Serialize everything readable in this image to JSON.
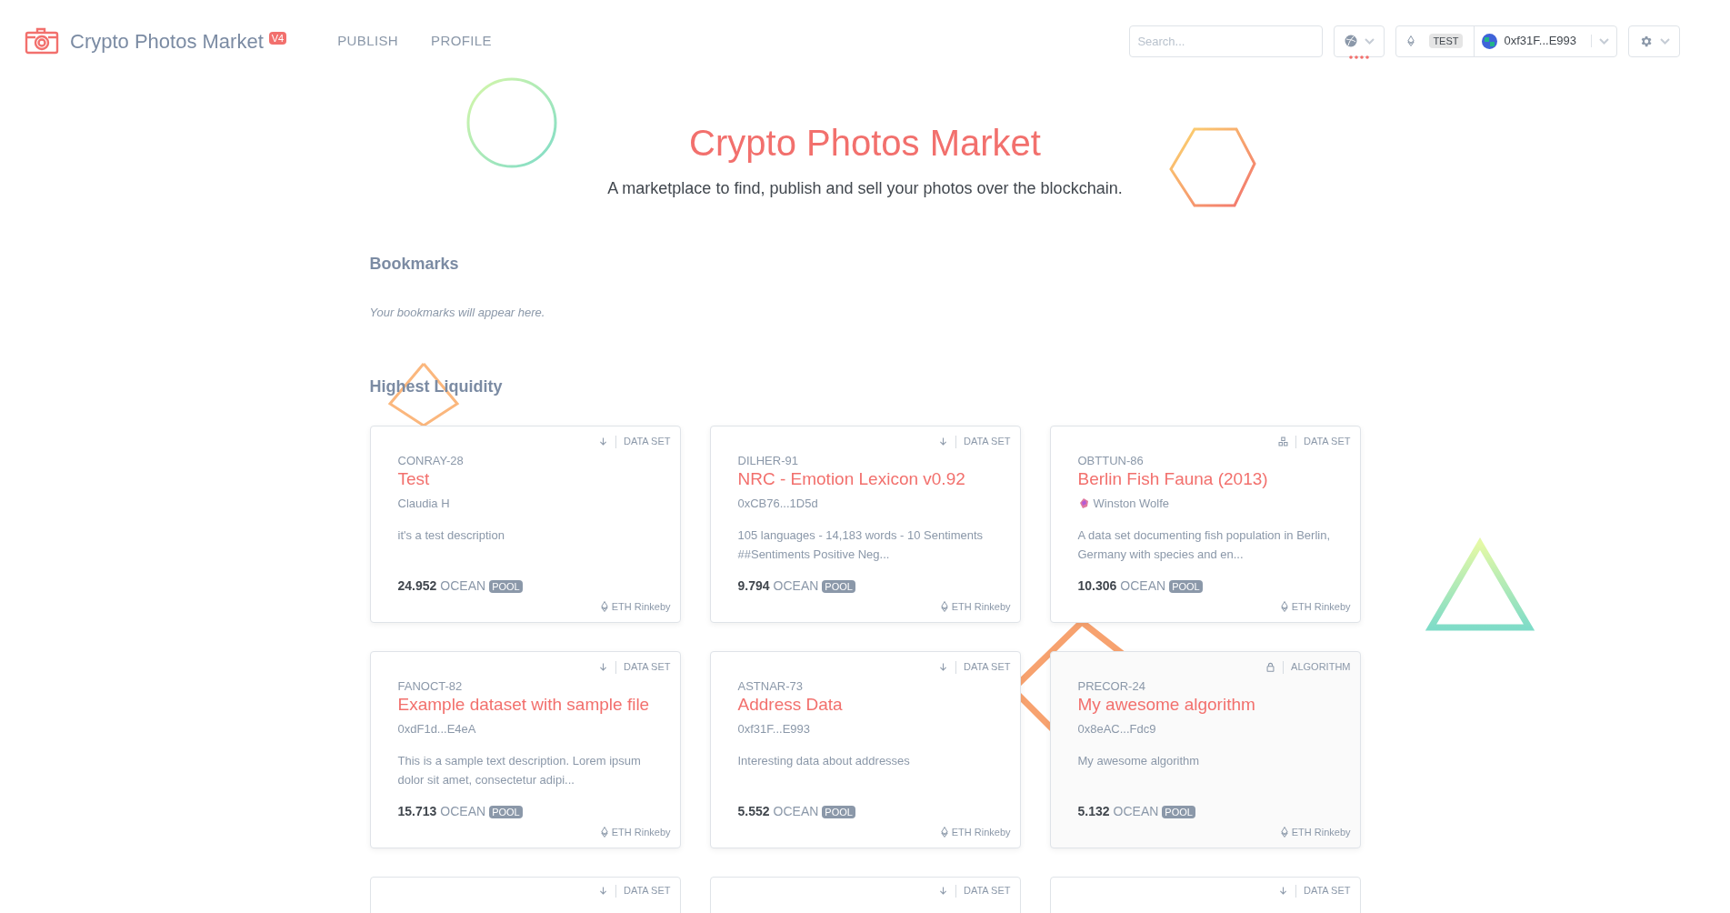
{
  "header": {
    "logo_text": "Crypto Photos Market",
    "badge": "V4",
    "nav": [
      "PUBLISH",
      "PROFILE"
    ],
    "search_placeholder": "Search...",
    "network_label": "TEST",
    "account": "0xf31F...E993"
  },
  "hero": {
    "title": "Crypto Photos Market",
    "subtitle": "A marketplace to find, publish and sell your photos over the blockchain."
  },
  "bookmarks": {
    "heading": "Bookmarks",
    "empty_text": "Your bookmarks will appear here."
  },
  "highest_liquidity": {
    "heading": "Highest Liquidity",
    "cards": [
      {
        "kind": "download",
        "type": "DATA SET",
        "symbol": "CONRAY-28",
        "name": "Test",
        "author": "Claudia H",
        "author_avatar": false,
        "description": "it's a test description",
        "price": "24.952",
        "currency": "OCEAN",
        "pool": "POOL",
        "network": "ETH Rinkeby"
      },
      {
        "kind": "download",
        "type": "DATA SET",
        "symbol": "DILHER-91",
        "name": "NRC - Emotion Lexicon v0.92",
        "author": "0xCB76...1D5d",
        "author_avatar": false,
        "description": "105 languages - 14,183 words - 10 Sentiments ##Sentiments Positive Neg...",
        "price": "9.794",
        "currency": "OCEAN",
        "pool": "POOL",
        "network": "ETH Rinkeby"
      },
      {
        "kind": "compute",
        "type": "DATA SET",
        "symbol": "OBTTUN-86",
        "name": "Berlin Fish Fauna (2013)",
        "author": "Winston Wolfe",
        "author_avatar": true,
        "description": "A data set documenting fish population in Berlin, Germany with species and en...",
        "price": "10.306",
        "currency": "OCEAN",
        "pool": "POOL",
        "network": "ETH Rinkeby"
      },
      {
        "kind": "download",
        "type": "DATA SET",
        "symbol": "FANOCT-82",
        "name": "Example dataset with sample file",
        "author": "0xdF1d...E4eA",
        "author_avatar": false,
        "description": "This is a sample text description. Lorem ipsum dolor sit amet, consectetur adipi...",
        "price": "15.713",
        "currency": "OCEAN",
        "pool": "POOL",
        "network": "ETH Rinkeby"
      },
      {
        "kind": "download",
        "type": "DATA SET",
        "symbol": "ASTNAR-73",
        "name": "Address Data",
        "author": "0xf31F...E993",
        "author_avatar": false,
        "description": "Interesting data about addresses",
        "price": "5.552",
        "currency": "OCEAN",
        "pool": "POOL",
        "network": "ETH Rinkeby"
      },
      {
        "kind": "lock",
        "type": "ALGORITHM",
        "symbol": "PRECOR-24",
        "name": "My awesome algorithm",
        "author": "0x8eAC...Fdc9",
        "author_avatar": false,
        "description": "My awesome algorithm",
        "price": "5.132",
        "currency": "OCEAN",
        "pool": "POOL",
        "network": "ETH Rinkeby"
      }
    ],
    "partial_cards": [
      {
        "kind": "download",
        "type": "DATA SET"
      },
      {
        "kind": "download",
        "type": "DATA SET"
      },
      {
        "kind": "download",
        "type": "DATA SET"
      }
    ]
  }
}
